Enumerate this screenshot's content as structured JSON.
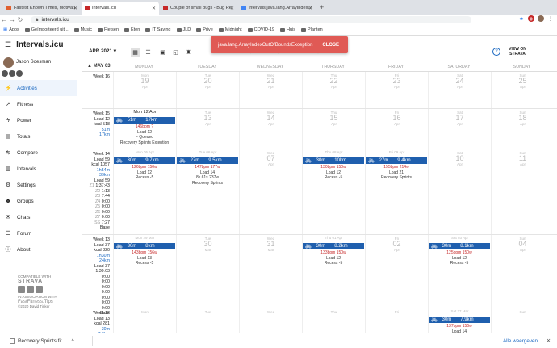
{
  "browser": {
    "tabs": [
      {
        "title": "Fastest Known Times, Motivati",
        "color": "#e06030",
        "active": false
      },
      {
        "title": "Intervals.icu",
        "color": "#c62828",
        "active": true
      },
      {
        "title": "Couple of small bugs - Bug Re",
        "color": "#c62828",
        "active": false
      },
      {
        "title": "intervals java.lang.ArrayIndexO",
        "color": "#4285f4",
        "active": false
      }
    ],
    "url": "intervals.icu",
    "bookmarks": [
      "Apps",
      "Geïmporteerd uit...",
      "Music",
      "Fietsen",
      "Eten",
      "IT Saving",
      "JLD",
      "Prive",
      "Midnight",
      "COVID-19",
      "Huis",
      "Planten"
    ]
  },
  "sidebar": {
    "brand": "Intervals.icu",
    "user": "Jason Soesman",
    "nav": [
      {
        "label": "Activities",
        "icon": "activity-icon",
        "glyph": "⚡",
        "active": true
      },
      {
        "label": "Fitness",
        "icon": "fitness-icon",
        "glyph": "↗",
        "active": false
      },
      {
        "label": "Power",
        "icon": "power-icon",
        "glyph": "ϟ",
        "active": false
      },
      {
        "label": "Totals",
        "icon": "totals-icon",
        "glyph": "▤",
        "active": false
      },
      {
        "label": "Compare",
        "icon": "compare-icon",
        "glyph": "↹",
        "active": false
      },
      {
        "label": "Intervals",
        "icon": "intervals-icon",
        "glyph": "▥",
        "active": false
      },
      {
        "label": "Settings",
        "icon": "settings-icon",
        "glyph": "⚙",
        "active": false
      },
      {
        "label": "Groups",
        "icon": "groups-icon",
        "glyph": "☻",
        "active": false
      },
      {
        "label": "Chats",
        "icon": "chats-icon",
        "glyph": "✉",
        "active": false
      },
      {
        "label": "Forum",
        "icon": "forum-icon",
        "glyph": "☰",
        "active": false
      },
      {
        "label": "About",
        "icon": "about-icon",
        "glyph": "ⓘ",
        "active": false
      }
    ],
    "footer": {
      "compatible": "COMPATIBLE WITH",
      "strava": "STRAVA",
      "association": "IN ASSOCIATION WITH",
      "fft": "FastFitness.Tips",
      "copyright": "©2020 David Tinker"
    }
  },
  "toolbar": {
    "month": "APR 2021",
    "options": "OPTIONS",
    "edit": "EDIT",
    "upload": "UPLOAD",
    "view_strava": "VIEW ON STRAVA"
  },
  "snackbar": {
    "message": "java.lang.ArrayIndexOutOfBoundsException",
    "close": "CLOSE"
  },
  "calendar": {
    "top_label": "MAY 03",
    "days": [
      "MONDAY",
      "TUESDAY",
      "WEDNESDAY",
      "THURSDAY",
      "FRIDAY",
      "SATURDAY",
      "SUNDAY"
    ],
    "weeks": [
      {
        "label": [
          "Week 16"
        ],
        "cells": [
          [
            "Mon",
            "19",
            "Apr"
          ],
          [
            "Tue",
            "20",
            "Apr"
          ],
          [
            "Wed",
            "21",
            "Apr"
          ],
          [
            "Thu",
            "22",
            "Apr"
          ],
          [
            "Fri",
            "23",
            "Apr"
          ],
          [
            "Sat",
            "24",
            "Apr"
          ],
          [
            "Sun",
            "25",
            "Apr"
          ]
        ]
      },
      {
        "label": [
          "Week 15",
          "Load 12",
          "kcal 518",
          "51m",
          "17km"
        ],
        "cells": [
          [
            "Mon",
            "12 Apr"
          ],
          [
            "Tue",
            "13",
            "Apr"
          ],
          [
            "Wed",
            "14",
            "Apr"
          ],
          [
            "Thu",
            "15",
            "Apr"
          ],
          [
            "Fri",
            "16",
            "Apr"
          ],
          [
            "Sat",
            "17",
            "Apr"
          ],
          [
            "Sun",
            "18",
            "Apr"
          ]
        ],
        "activity": {
          "time": "51m",
          "dist": "17km",
          "hr": "146bpm ?",
          "load": "Load 12",
          "status": "Queued",
          "name": "Recovery Sprints Extention"
        }
      },
      {
        "label": [
          "Week 14",
          "Load 59",
          "kcal 1057",
          "1h54m",
          "39km",
          "Load 59",
          "1:37:43",
          "1:13",
          "7:44",
          "0:00",
          "0:00",
          "0:00",
          "0:00",
          "7:27",
          "Base"
        ],
        "zones": [
          "Z1",
          "Z2",
          "Z3",
          "Z4",
          "Z5",
          "Z6",
          "Z7",
          "SS"
        ],
        "cells": [
          [
            "Mon",
            "05",
            "Apr"
          ],
          [
            "Tue",
            "06",
            "Apr"
          ],
          [
            "Wed",
            "07",
            "Apr"
          ],
          [
            "Thu",
            "08",
            "Apr"
          ],
          [
            "Fri",
            "09",
            "Apr"
          ],
          [
            "Sat",
            "10",
            "Apr"
          ],
          [
            "Sun",
            "11",
            "Apr"
          ]
        ],
        "acts": [
          {
            "col": 0,
            "time": "30m",
            "dist": "9.7km",
            "hr": "126bpm 150w",
            "load": "Load 12",
            "extra": "Recess -5"
          },
          {
            "col": 1,
            "time": "27m",
            "dist": "9.5km",
            "hr": "147bpm 177w",
            "load": "Load 14",
            "extra": "8x 61s 237w",
            "name": "Recovery Sprints"
          },
          {
            "col": 3,
            "time": "30m",
            "dist": "10km",
            "hr": "130bpm 150w",
            "load": "Load 12",
            "extra": "Recess -5"
          },
          {
            "col": 4,
            "time": "27m",
            "dist": "9.4km",
            "hr": "155bpm 214w",
            "load": "Load 21",
            "extra": "Recovery Sprints"
          }
        ]
      },
      {
        "label": [
          "Week 13",
          "Load 37",
          "kcal 820",
          "1h30m",
          "24km",
          "Load 37",
          "1:30:03",
          "0:00",
          "0:00",
          "0:00",
          "0:00",
          "0:00",
          "0:00",
          "0:00",
          "Base"
        ],
        "cells": [
          [
            "Mon",
            "29",
            "Mar"
          ],
          [
            "Tue",
            "30",
            "Mar"
          ],
          [
            "Wed",
            "31",
            "Mar"
          ],
          [
            "Thu",
            "01",
            "Apr"
          ],
          [
            "Fri",
            "02",
            "Apr"
          ],
          [
            "Sat",
            "03",
            "Apr"
          ],
          [
            "Sun",
            "04",
            "Apr"
          ]
        ],
        "acts": [
          {
            "col": 0,
            "time": "30m",
            "dist": "8km",
            "hr": "143bpm 156w",
            "load": "Load 13",
            "extra": "Recess -5"
          },
          {
            "col": 3,
            "time": "30m",
            "dist": "8.2km",
            "hr": "133bpm 150w",
            "load": "Load 12",
            "extra": "Recess -5"
          },
          {
            "col": 5,
            "time": "30m",
            "dist": "8.1km",
            "hr": "125bpm 150w",
            "load": "Load 12",
            "extra": "Recess -5"
          }
        ]
      },
      {
        "label": [
          "Week 12",
          "Load 13",
          "kcal 281",
          "30m",
          "7.9km"
        ],
        "cells": [
          [
            "Mon",
            "",
            ""
          ],
          [
            "Tue",
            "",
            ""
          ],
          [
            "Wed",
            "",
            ""
          ],
          [
            "Thu",
            "",
            ""
          ],
          [
            "Fri",
            "",
            ""
          ],
          [
            "Sat",
            "27 Mar",
            ""
          ],
          [
            "Sun",
            "",
            ""
          ]
        ],
        "acts": [
          {
            "col": 5,
            "time": "30m",
            "dist": "7.9km",
            "hr": "137bpm 156w",
            "load": "Load 14",
            "extra": ""
          }
        ]
      }
    ]
  },
  "download": {
    "file": "Recovery Sprints.fit",
    "show_all": "Alle weergeven",
    "close": "✕"
  }
}
